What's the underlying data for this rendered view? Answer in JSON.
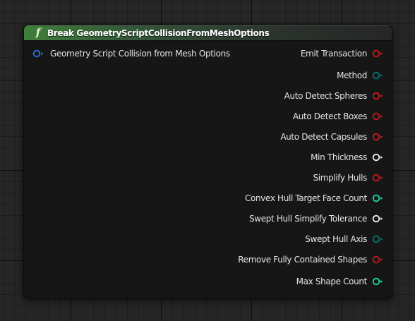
{
  "node": {
    "title": "Break GeometryScriptCollisionFromMeshOptions",
    "function_icon_glyph": "f",
    "function_icon_name": "function-icon",
    "header_color": "#3f7f38",
    "input_pin": {
      "label": "Geometry Script Collision from Mesh Options",
      "color": "#1e6fd6",
      "icon": "struct-pin-icon"
    },
    "output_pins": [
      {
        "label": "Emit Transaction",
        "color": "#c4191d",
        "icon": "bool-pin-icon"
      },
      {
        "label": "Method",
        "color": "#07706a",
        "icon": "enum-pin-icon"
      },
      {
        "label": "Auto Detect Spheres",
        "color": "#c4191d",
        "icon": "bool-pin-icon"
      },
      {
        "label": "Auto Detect Boxes",
        "color": "#c4191d",
        "icon": "bool-pin-icon"
      },
      {
        "label": "Auto Detect Capsules",
        "color": "#c4191d",
        "icon": "bool-pin-icon"
      },
      {
        "label": "Min Thickness",
        "color": "#e8e8e8",
        "icon": "float-pin-icon"
      },
      {
        "label": "Simplify Hulls",
        "color": "#c4191d",
        "icon": "bool-pin-icon"
      },
      {
        "label": "Convex Hull Target Face Count",
        "color": "#1fd1a2",
        "icon": "int-pin-icon"
      },
      {
        "label": "Swept Hull Simplify Tolerance",
        "color": "#e8e8e8",
        "icon": "float-pin-icon"
      },
      {
        "label": "Swept Hull Axis",
        "color": "#07706a",
        "icon": "enum-pin-icon"
      },
      {
        "label": "Remove Fully Contained Shapes",
        "color": "#c4191d",
        "icon": "bool-pin-icon"
      },
      {
        "label": "Max Shape Count",
        "color": "#1fd1a2",
        "icon": "int-pin-icon"
      }
    ]
  }
}
